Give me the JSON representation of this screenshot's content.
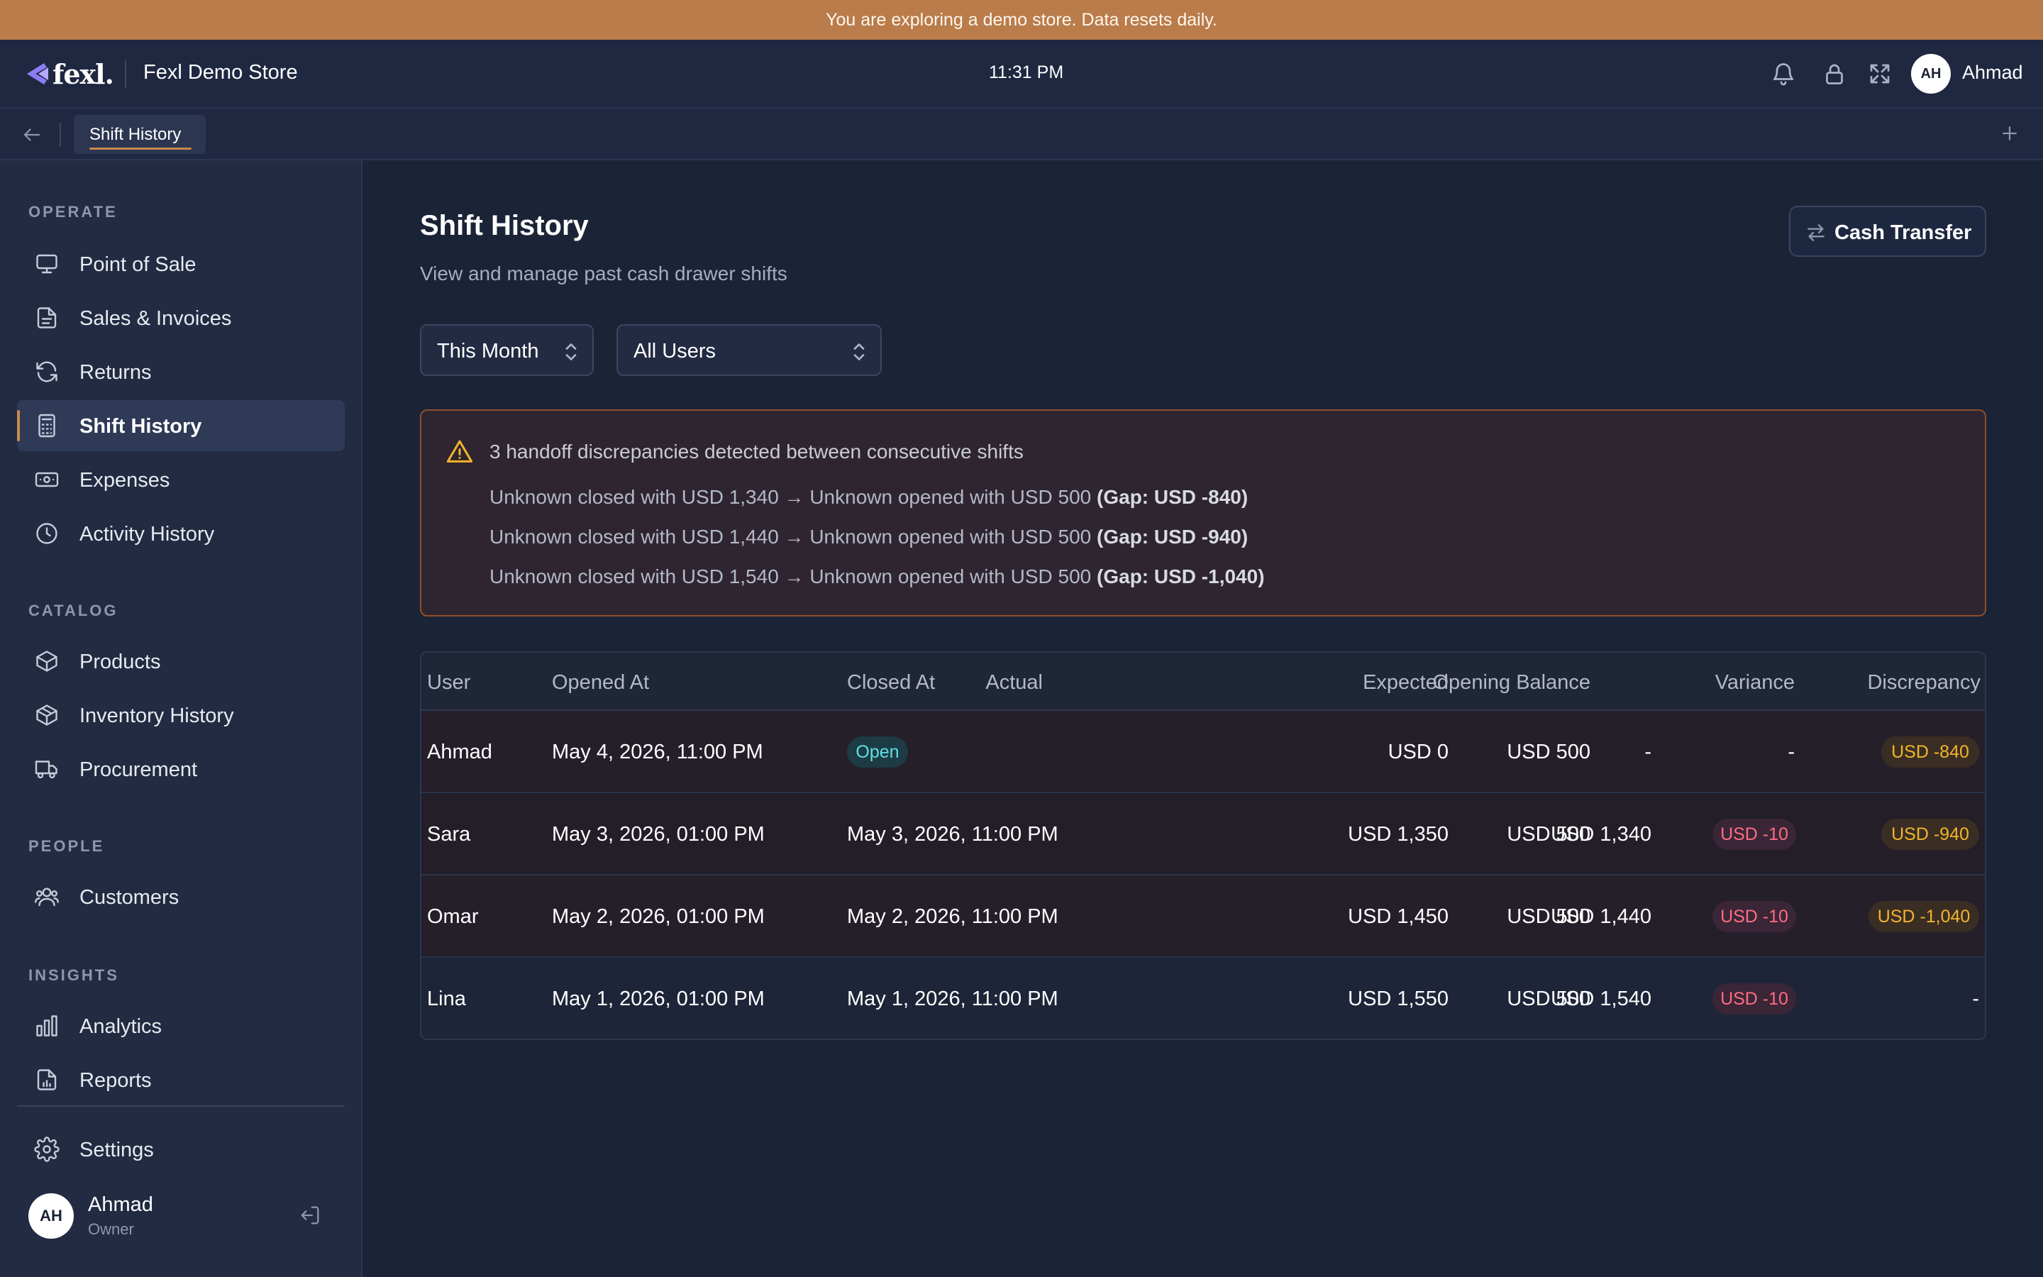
{
  "banner": {
    "text": "You are exploring a demo store. Data resets daily."
  },
  "header": {
    "brand": "fexl.",
    "store_name": "Fexl Demo Store",
    "time": "11:31 PM",
    "user_initials": "AH",
    "user_name": "Ahmad"
  },
  "tabs": {
    "active": "Shift History"
  },
  "sidebar": {
    "sections": {
      "operate": "OPERATE",
      "catalog": "CATALOG",
      "people": "PEOPLE",
      "insights": "INSIGHTS"
    },
    "items": {
      "pos": "Point of Sale",
      "sales": "Sales & Invoices",
      "returns": "Returns",
      "shift_history": "Shift History",
      "expenses": "Expenses",
      "activity": "Activity History",
      "products": "Products",
      "inventory": "Inventory History",
      "procurement": "Procurement",
      "customers": "Customers",
      "analytics": "Analytics",
      "reports": "Reports",
      "settings": "Settings"
    },
    "active": "shift_history",
    "user": {
      "initials": "AH",
      "name": "Ahmad",
      "role": "Owner"
    }
  },
  "main": {
    "title": "Shift History",
    "subtitle": "View and manage past cash drawer shifts",
    "cash_transfer_label": "Cash Transfer",
    "filters": {
      "period": "This Month",
      "user": "All Users"
    },
    "alert": {
      "title": "3 handoff discrepancies detected between consecutive shifts",
      "lines": [
        {
          "text": "Unknown closed with USD 1,340 → Unknown opened with USD 500 ",
          "gap": "(Gap: USD -840)"
        },
        {
          "text": "Unknown closed with USD 1,440 → Unknown opened with USD 500 ",
          "gap": "(Gap: USD -940)"
        },
        {
          "text": "Unknown closed with USD 1,540 → Unknown opened with USD 500 ",
          "gap": "(Gap: USD -1,040)"
        }
      ]
    },
    "table": {
      "headers": {
        "user": "User",
        "opened_at": "Opened At",
        "closed_at": "Closed At",
        "opening_balance": "Opening Balance",
        "expected": "Expected",
        "actual": "Actual",
        "variance": "Variance",
        "discrepancy": "Discrepancy"
      },
      "rows": [
        {
          "user": "Ahmad",
          "opened_at": "May 4, 2026, 11:00 PM",
          "closed_at": "Open",
          "opening_balance": "USD 500",
          "expected": "USD 0",
          "actual": "-",
          "variance": "-",
          "discrepancy": "USD -840"
        },
        {
          "user": "Sara",
          "opened_at": "May 3, 2026, 01:00 PM",
          "closed_at": "May 3, 2026, 11:00 PM",
          "opening_balance": "USD 500",
          "expected": "USD 1,350",
          "actual": "USD 1,340",
          "variance": "USD -10",
          "discrepancy": "USD -940"
        },
        {
          "user": "Omar",
          "opened_at": "May 2, 2026, 01:00 PM",
          "closed_at": "May 2, 2026, 11:00 PM",
          "opening_balance": "USD 500",
          "expected": "USD 1,450",
          "actual": "USD 1,440",
          "variance": "USD -10",
          "discrepancy": "USD -1,040"
        },
        {
          "user": "Lina",
          "opened_at": "May 1, 2026, 01:00 PM",
          "closed_at": "May 1, 2026, 11:00 PM",
          "opening_balance": "USD 500",
          "expected": "USD 1,550",
          "actual": "USD 1,540",
          "variance": "USD -10",
          "discrepancy": "-"
        }
      ]
    }
  },
  "colors": {
    "accent": "#c98a4e",
    "banner": "#b97c4a",
    "background": "#1b2336",
    "sidebar": "#222b42",
    "warning": "#f2b42a",
    "danger": "#ff6b81",
    "open_badge": "#5ee0e5"
  }
}
